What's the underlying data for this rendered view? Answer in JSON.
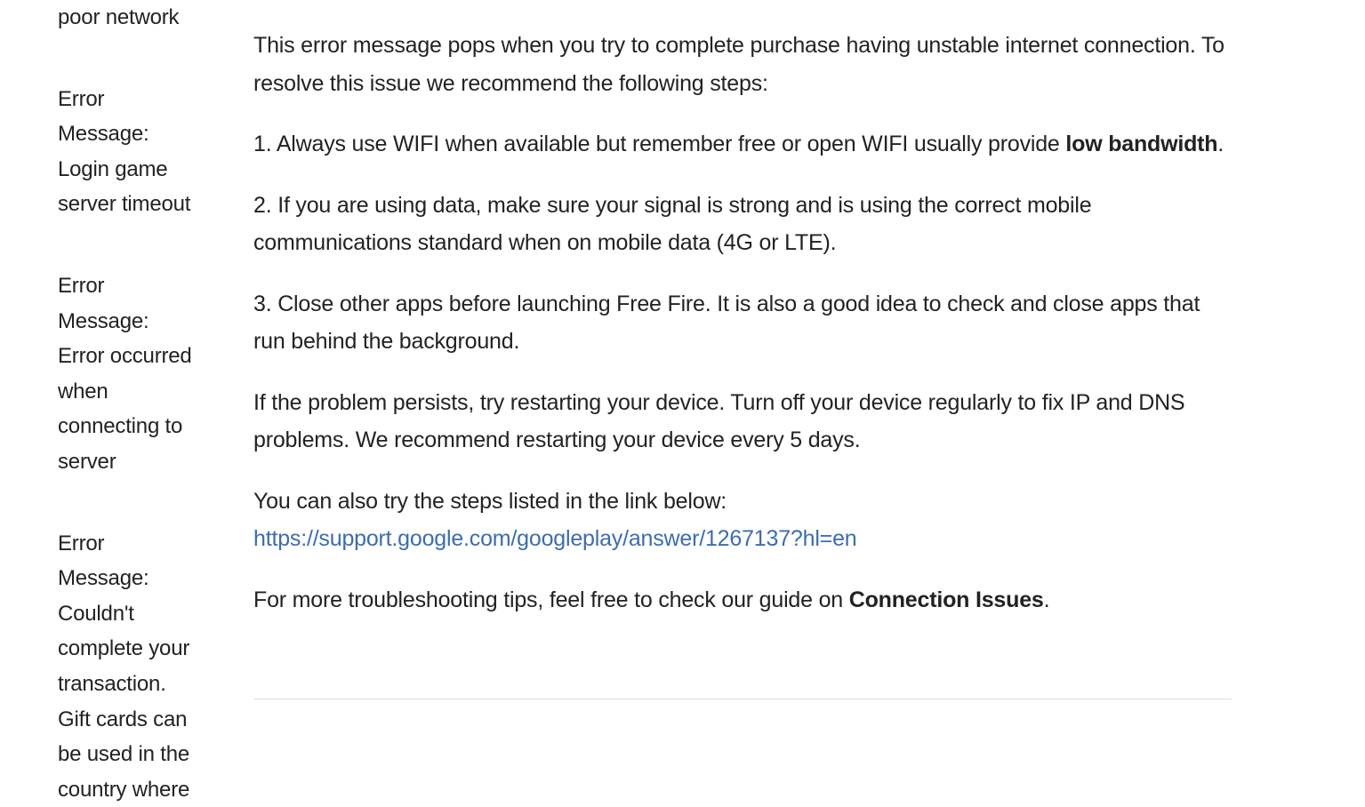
{
  "sidebar": {
    "items": [
      {
        "label": "poor network"
      },
      {
        "label": "Error Message: Login game server timeout"
      },
      {
        "label": "Error Message: Error occurred when connecting to server"
      },
      {
        "label": "Error Message: Couldn't complete your transaction. Gift cards can be used in the country where"
      }
    ]
  },
  "article": {
    "intro": "This error message pops when you try to complete purchase having unstable internet connection. To resolve this issue we recommend the following steps:",
    "step1_prefix": "1. Always use WIFI when available but remember free or open WIFI usually provide ",
    "step1_bold": "low bandwidth",
    "step1_suffix": ".",
    "step2": "2. If you are using data, make sure your signal is strong and is using the correct mobile communications standard when on mobile data (4G or LTE).",
    "step3": "3. Close other apps before launching Free Fire. It is also a good idea to check and close apps that run behind the background.",
    "persist": "If the problem persists, try restarting your device. Turn off your device regularly to fix IP and DNS problems. We recommend restarting your device every 5 days.",
    "try_also": "You can also try the steps listed in the link below:",
    "link_text": "https://support.google.com/googleplay/answer/1267137?hl=en",
    "more_prefix": "For more troubleshooting tips, feel free to check our guide on ",
    "more_bold": "Connection Issues",
    "more_suffix": "."
  }
}
